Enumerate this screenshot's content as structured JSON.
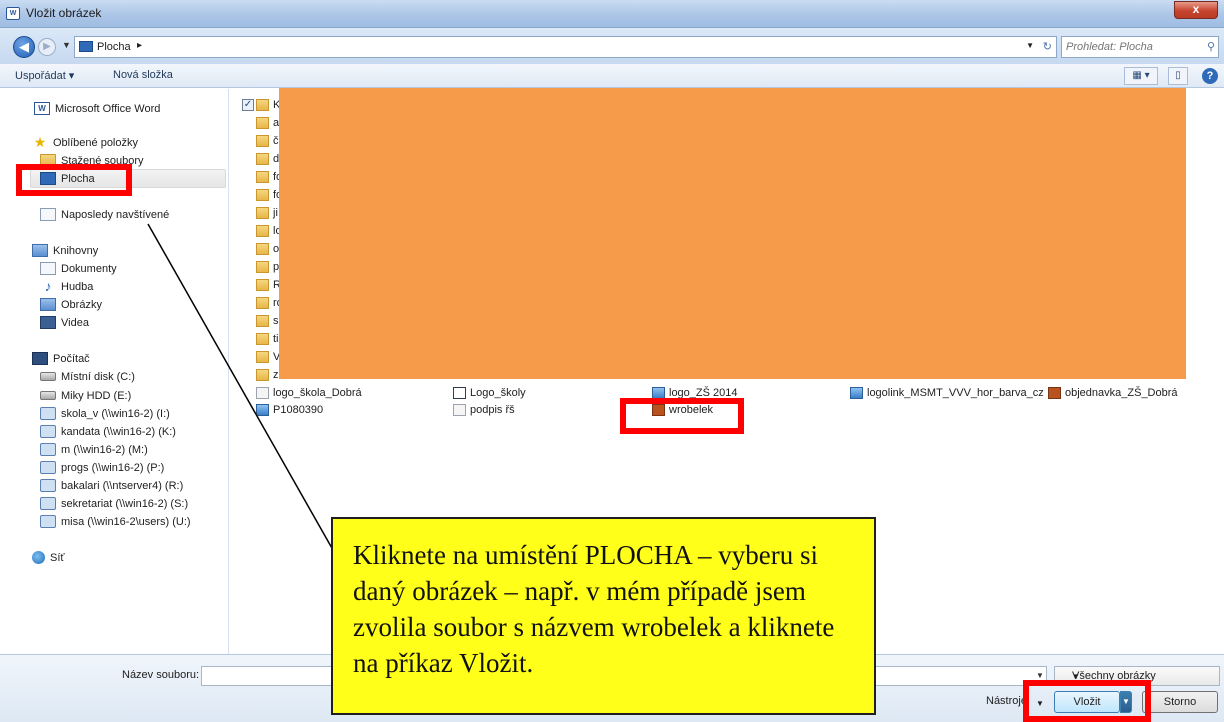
{
  "window": {
    "title": "Vložit obrázek",
    "close_label": "x",
    "app_icon_label": "W"
  },
  "address": {
    "location": "Plocha",
    "separator": "▸",
    "search_placeholder": "Prohledat: Plocha"
  },
  "toolbar": {
    "organize_label": "Uspořádat ▾",
    "new_folder_label": "Nová složka",
    "view_label": "▦ ▾",
    "help_label": "?"
  },
  "sidebar": {
    "top": [
      {
        "label": "Microsoft Office Word",
        "icon": "word-icon"
      }
    ],
    "favorites_label": "Oblíbené položky",
    "favorites": [
      {
        "label": "Stažené soubory",
        "icon": "folder-icon"
      },
      {
        "label": "Plocha",
        "icon": "desktop-icon"
      },
      {
        "label": "Naposledy navštívené",
        "icon": "recent-icon"
      }
    ],
    "libraries_label": "Knihovny",
    "libraries": [
      {
        "label": "Dokumenty",
        "icon": "documents-icon"
      },
      {
        "label": "Hudba",
        "icon": "music-icon"
      },
      {
        "label": "Obrázky",
        "icon": "pictures-icon"
      },
      {
        "label": "Videa",
        "icon": "videos-icon"
      }
    ],
    "computer_label": "Počítač",
    "drives": [
      {
        "label": "Místní disk (C:)",
        "icon": "local-disk-icon"
      },
      {
        "label": "Miky HDD (E:)",
        "icon": "hdd-icon"
      },
      {
        "label": "skola_v (\\\\win16-2) (I:)",
        "icon": "network-drive-icon"
      },
      {
        "label": "kandata (\\\\win16-2) (K:)",
        "icon": "network-drive-icon"
      },
      {
        "label": "m (\\\\win16-2) (M:)",
        "icon": "network-drive-icon"
      },
      {
        "label": "progs (\\\\win16-2) (P:)",
        "icon": "network-drive-icon"
      },
      {
        "label": "bakalari (\\\\ntserver4) (R:)",
        "icon": "network-drive-icon"
      },
      {
        "label": "sekretariat (\\\\win16-2) (S:)",
        "icon": "network-drive-icon"
      },
      {
        "label": "misa (\\\\win16-2\\users) (U:)",
        "icon": "network-drive-icon"
      }
    ],
    "network_label": "Síť"
  },
  "files": {
    "first_folder_initial": "K",
    "folder_initials": [
      "a",
      "č",
      "d",
      "fo",
      "fo",
      "ji",
      "lo",
      "o",
      "p",
      "R",
      "ro",
      "sp",
      "ti",
      "V",
      "za"
    ],
    "items": [
      {
        "label": "logo_škola_Dobrá",
        "icon": "file-icon"
      },
      {
        "label": "Logo_školy",
        "icon": "spreadsheet-icon"
      },
      {
        "label": "logo_ZŠ 2014",
        "icon": "image-icon"
      },
      {
        "label": "logolink_MSMT_VVV_hor_barva_cz",
        "icon": "image-icon"
      },
      {
        "label": "objednavka_ZŠ_Dobrá",
        "icon": "publisher-icon"
      },
      {
        "label": "P1080390",
        "icon": "image-icon"
      },
      {
        "label": "podpis řš",
        "icon": "file-icon"
      },
      {
        "label": "wrobelek",
        "icon": "publisher-icon"
      }
    ]
  },
  "bottom": {
    "filename_label": "Název souboru:",
    "filename_value": "",
    "filter_value": "Všechny obrázky",
    "tools_label": "Nástroje",
    "insert_label": "Vložit",
    "cancel_label": "Storno"
  },
  "callout": {
    "text": "Kliknete na umístění PLOCHA – vyberu si daný obrázek – např. v mém případě jsem zvolila soubor s názvem wrobelek a kliknete na příkaz Vložit."
  },
  "colors": {
    "highlight": "#ff0000",
    "callout_bg": "#ffff1a",
    "redaction": "#f59b4a"
  }
}
